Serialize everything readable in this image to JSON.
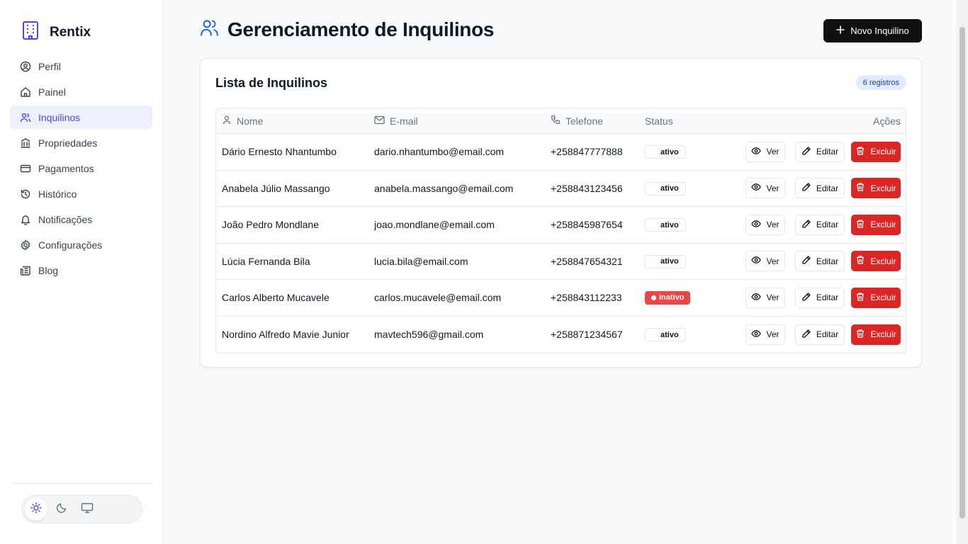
{
  "app": {
    "name": "Rentix"
  },
  "sidebar": {
    "items": [
      {
        "label": "Perfil",
        "icon": "user-circle-icon"
      },
      {
        "label": "Painel",
        "icon": "home-icon"
      },
      {
        "label": "Inquilinos",
        "icon": "users-icon",
        "active": true
      },
      {
        "label": "Propriedades",
        "icon": "building-icon"
      },
      {
        "label": "Pagamentos",
        "icon": "credit-card-icon"
      },
      {
        "label": "Histórico",
        "icon": "history-icon"
      },
      {
        "label": "Notificações",
        "icon": "bell-icon"
      },
      {
        "label": "Configurações",
        "icon": "gear-icon"
      },
      {
        "label": "Blog",
        "icon": "newspaper-icon"
      }
    ],
    "theme": {
      "options": [
        "light",
        "dark",
        "system"
      ],
      "selected": "light"
    }
  },
  "header": {
    "title": "Gerenciamento de Inquilinos",
    "new_button_label": "Novo Inquilino"
  },
  "list": {
    "title": "Lista de Inquilinos",
    "count_label": "6 registros",
    "columns": {
      "name": "Nome",
      "email": "E-mail",
      "phone": "Telefone",
      "status": "Status",
      "actions": "Ações"
    },
    "actions": {
      "view": "Ver",
      "edit": "Editar",
      "delete": "Excluir"
    },
    "rows": [
      {
        "name": "Dário Ernesto Nhantumbo",
        "email": "dario.nhantumbo@email.com",
        "phone": "+258847777888",
        "status": "ativo"
      },
      {
        "name": "Anabela Júlio Massango",
        "email": "anabela.massango@email.com",
        "phone": "+258843123456",
        "status": "ativo"
      },
      {
        "name": "João Pedro Mondlane",
        "email": "joao.mondlane@email.com",
        "phone": "+258845987654",
        "status": "ativo"
      },
      {
        "name": "Lúcia Fernanda Bila",
        "email": "lucia.bila@email.com",
        "phone": "+258847654321",
        "status": "ativo"
      },
      {
        "name": "Carlos Alberto Mucavele",
        "email": "carlos.mucavele@email.com",
        "phone": "+258843112233",
        "status": "inativo"
      },
      {
        "name": "Nordino Alfredo Mavie Junior",
        "email": "mavtech596@gmail.com",
        "phone": "+258871234567",
        "status": "ativo"
      }
    ]
  },
  "colors": {
    "accent": "#4f46e5",
    "primary_button": "#111111",
    "danger": "#dc2626",
    "inactive_badge": "#ef4444"
  }
}
